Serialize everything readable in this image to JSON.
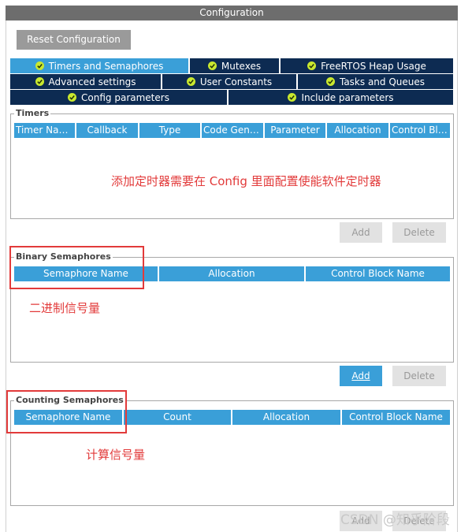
{
  "window": {
    "title": "Configuration"
  },
  "toolbar": {
    "reset_label": "Reset Configuration"
  },
  "tabs_row1": [
    {
      "label": "Timers and Semaphores",
      "active": true
    },
    {
      "label": "Mutexes",
      "active": false
    },
    {
      "label": "FreeRTOS Heap Usage",
      "active": false
    }
  ],
  "tabs_row2": [
    {
      "label": "Advanced settings"
    },
    {
      "label": "User Constants"
    },
    {
      "label": "Tasks and Queues"
    }
  ],
  "tabs_row3": [
    {
      "label": "Config parameters"
    },
    {
      "label": "Include parameters"
    }
  ],
  "timers": {
    "legend": "Timers",
    "columns": [
      "Timer Name",
      "Callback",
      "Type",
      "Code Gene...",
      "Parameter",
      "Allocation",
      "Control Blo..."
    ],
    "add_label": "Add",
    "delete_label": "Delete"
  },
  "binary": {
    "legend": "Binary Semaphores",
    "columns": [
      "Semaphore Name",
      "Allocation",
      "Control Block Name"
    ],
    "add_label": "Add",
    "delete_label": "Delete"
  },
  "counting": {
    "legend": "Counting Semaphores",
    "columns": [
      "Semaphore Name",
      "Count",
      "Allocation",
      "Control Block Name"
    ],
    "add_label": "Add",
    "delete_label": "Delete"
  },
  "annotations": {
    "timers_note": "添加定时器需要在 Config 里面配置使能软件定时器",
    "binary_note": "二进制信号量",
    "counting_note": "计算信号量"
  },
  "watermark": {
    "text": "CSDN @知乎阶段"
  },
  "colors": {
    "title_bar": "#6d6d6d",
    "tab_dark": "#0d2b52",
    "tab_active": "#3a9fd8",
    "check": "#c9e82f",
    "annotation": "#e23a3a"
  }
}
